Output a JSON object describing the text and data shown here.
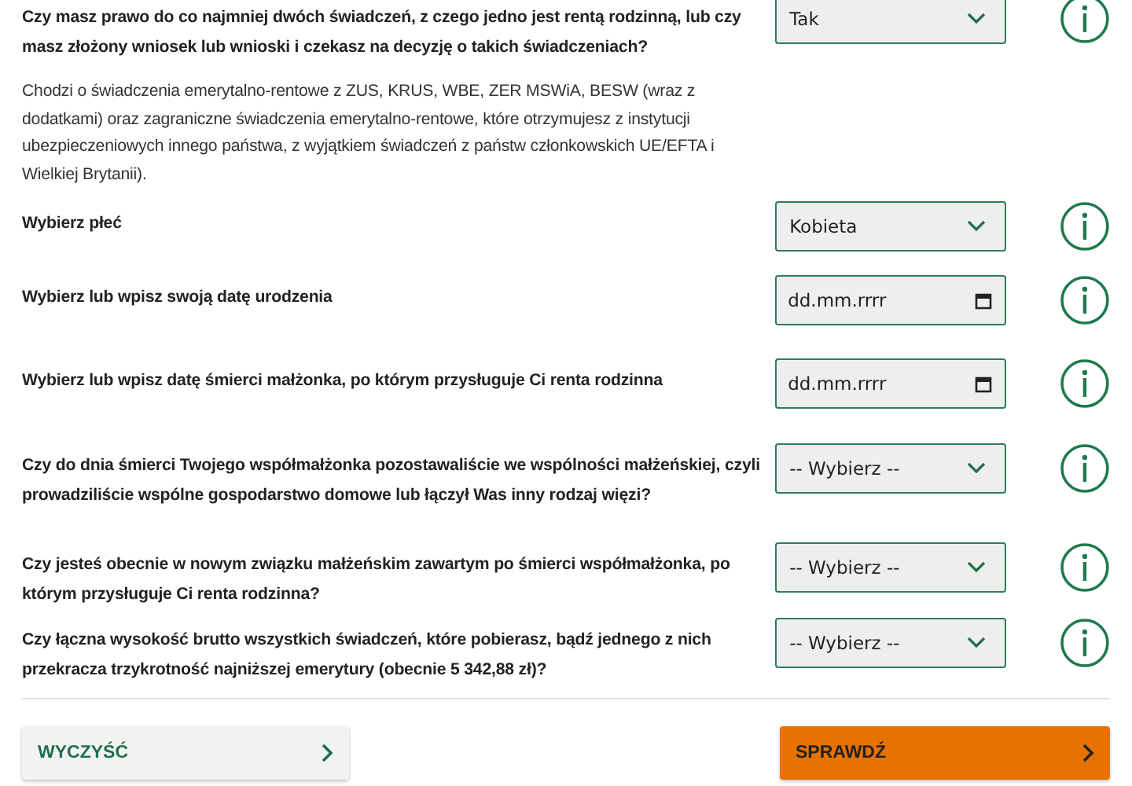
{
  "questions": [
    {
      "label": "Czy masz prawo do co najmniej dwóch świadczeń, z czego jedno jest rentą rodzinną, lub czy masz złożony wniosek lub wnioski i czekasz na decyzję o takich świadczeniach?",
      "description": "Chodzi o świadczenia emerytalno-rentowe z ZUS, KRUS, WBE, ZER MSWiA, BESW (wraz z dodatkami) oraz zagraniczne świadczenia emerytalno-rentowe, które otrzymujesz z instytucji ubezpieczeniowych innego państwa, z wyjątkiem świadczeń z państw członkowskich UE/EFTA i Wielkiej Brytanii).",
      "kind": "select",
      "value": "Tak"
    },
    {
      "label": "Wybierz płeć",
      "kind": "select",
      "value": "Kobieta"
    },
    {
      "label": "Wybierz lub wpisz swoją datę urodzenia",
      "kind": "date",
      "placeholder": "dd.mm.rrrr"
    },
    {
      "label": "Wybierz lub wpisz datę śmierci małżonka, po którym przysługuje Ci renta rodzinna",
      "kind": "date",
      "placeholder": "dd.mm.rrrr"
    },
    {
      "label": "Czy do dnia śmierci Twojego współmałżonka pozostawaliście we wspólności małżeńskiej, czyli prowadziliście wspólne gospodarstwo domowe lub łączył Was inny rodzaj więzi?",
      "kind": "select",
      "value": "-- Wybierz --"
    },
    {
      "label": "Czy jesteś obecnie w nowym związku małżeńskim zawartym po śmierci współmałżonka, po którym przysługuje Ci renta rodzinna?",
      "kind": "select",
      "value": "-- Wybierz --"
    },
    {
      "label": "Czy łączna wysokość brutto wszystkich świadczeń, które pobierasz, bądź jednego z nich przekracza trzykrotność najniższej emerytury (obecnie 5 342,88 zł)?",
      "kind": "select",
      "value": "-- Wybierz --"
    }
  ],
  "buttons": [
    {
      "label": "WYCZYŚĆ",
      "kind": "secondary"
    },
    {
      "label": "SPRAWDŹ",
      "kind": "primary"
    }
  ]
}
